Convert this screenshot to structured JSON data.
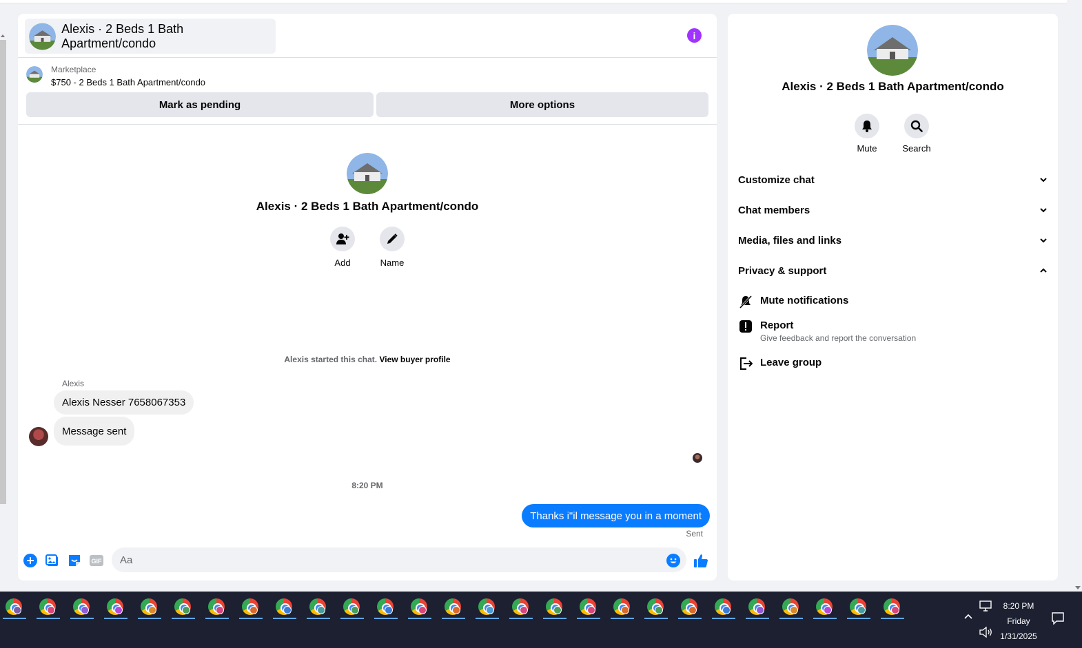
{
  "chat": {
    "title": "Alexis · 2 Beds 1 Bath Apartment/condo",
    "marketplace_label": "Marketplace",
    "listing": "$750 - 2 Beds 1 Bath Apartment/condo",
    "mark_pending": "Mark as pending",
    "more_options": "More options",
    "actions": {
      "add": "Add",
      "name": "Name"
    },
    "started_prefix": "Alexis started this chat.",
    "view_profile": "View buyer profile",
    "sender_name": "Alexis",
    "messages": [
      "Alexis Nesser 7658067353",
      "Message sent"
    ],
    "timestamp": "8:20 PM",
    "outgoing": "Thanks i\"il message you in a moment",
    "status": "Sent",
    "input_placeholder": "Aa"
  },
  "sidebar": {
    "title": "Alexis · 2 Beds 1 Bath Apartment/condo",
    "mute": "Mute",
    "search": "Search",
    "sections": [
      "Customize chat",
      "Chat members",
      "Media, files and links",
      "Privacy & support"
    ],
    "privacy_options": {
      "mute_notifications": "Mute notifications",
      "report": "Report",
      "report_sub": "Give feedback and report the conversation",
      "leave_group": "Leave group"
    }
  },
  "taskbar": {
    "time": "8:20 PM",
    "day": "Friday",
    "date": "1/31/2025",
    "profile_colors": [
      "#7b5ea7",
      "#d9467a",
      "#8f5bd6",
      "#b44ad6",
      "#d98a2b",
      "#4a9c5a",
      "#d9467a",
      "#d96a2b",
      "#3a7bd5",
      "#4a9c9c",
      "#4a9c5a",
      "#3a7bd5",
      "#d9467a",
      "#d96a2b",
      "#4a9cd6",
      "#d9467a",
      "#4a9c5a",
      "#d9467a",
      "#d96a2b",
      "#4a9c5a",
      "#d96a2b",
      "#3a7bd5",
      "#8f5bd6",
      "#d98a2b",
      "#b44ad6",
      "#4a9c9c",
      "#d9467a"
    ]
  },
  "colors": {
    "accent": "#0a7cff",
    "info": "#a033ff"
  }
}
